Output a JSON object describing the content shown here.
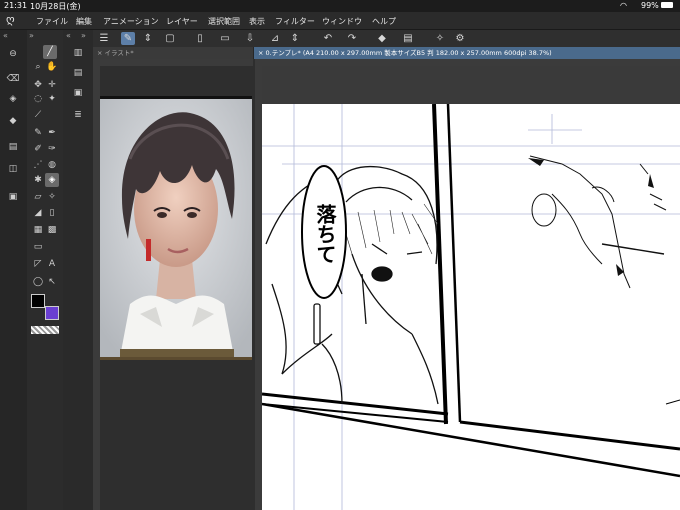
{
  "status_bar": {
    "time": "21:31",
    "date": "10月28日(金)",
    "battery": "99%"
  },
  "menu": {
    "items": [
      "ファイル",
      "編集",
      "アニメーション",
      "レイヤー",
      "選択範囲",
      "表示",
      "フィルター",
      "ウィンドウ",
      "ヘルプ"
    ]
  },
  "tabs": [
    {
      "label": "イラスト*"
    },
    {
      "label": "0.テンプレ* (A4 210.00 x 297.00mm 製本サイズB5 判 182.00 x 257.00mm 600dpi 38.7%)"
    }
  ],
  "speech_bubble": {
    "text": "落ちて"
  },
  "colors": {
    "main_color": "#000000",
    "sub_color": "#6a3fd1",
    "accent_tab": "#4a6a8c",
    "selected_command": "#5d7fa8"
  }
}
